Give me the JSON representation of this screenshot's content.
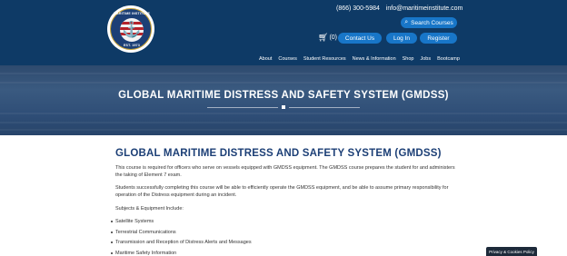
{
  "logo": {
    "top_text": "MARITIME INSTITUTE",
    "est_text": "EST. 1973"
  },
  "header": {
    "phone": "(866) 300-5984",
    "email": "info@maritimeinstitute.com",
    "search_label": "Search Courses",
    "cart_count": "(0)",
    "contact_label": "Contact Us",
    "login_label": "Log In",
    "register_label": "Register",
    "nav": [
      "About",
      "Courses",
      "Student Resources",
      "News & Information",
      "Shop",
      "Jobs",
      "Bootcamp"
    ]
  },
  "hero": {
    "title": "GLOBAL MARITIME DISTRESS AND SAFETY SYSTEM (GMDSS)"
  },
  "main": {
    "title": "GLOBAL MARITIME DISTRESS AND SAFETY SYSTEM (GMDSS)",
    "paragraph1": "This course is required for officers who serve on vessels equipped with GMDSS equipment. The GMDSS course prepares the student for and administers the taking of Element 7 exam.",
    "paragraph2": "Students successfully completing this course will be able to efficiently operate the GMDSS equipment, and be able to assume primary responsibility for operation of the Distress equipment during an incident.",
    "subjects_heading": "Subjects & Equipment Include:",
    "subjects": [
      "Satellite Systems",
      "Terrestrial Communications",
      "Transmission and Reception of Distress Alerts and Messages",
      "Maritime Safety Information"
    ]
  },
  "footer": {
    "policy_label": "Privacy & Cookies Policy"
  },
  "colors": {
    "header_bg": "#0e3a66",
    "button_blue": "#1876c8",
    "title_navy": "#1c3f76"
  }
}
